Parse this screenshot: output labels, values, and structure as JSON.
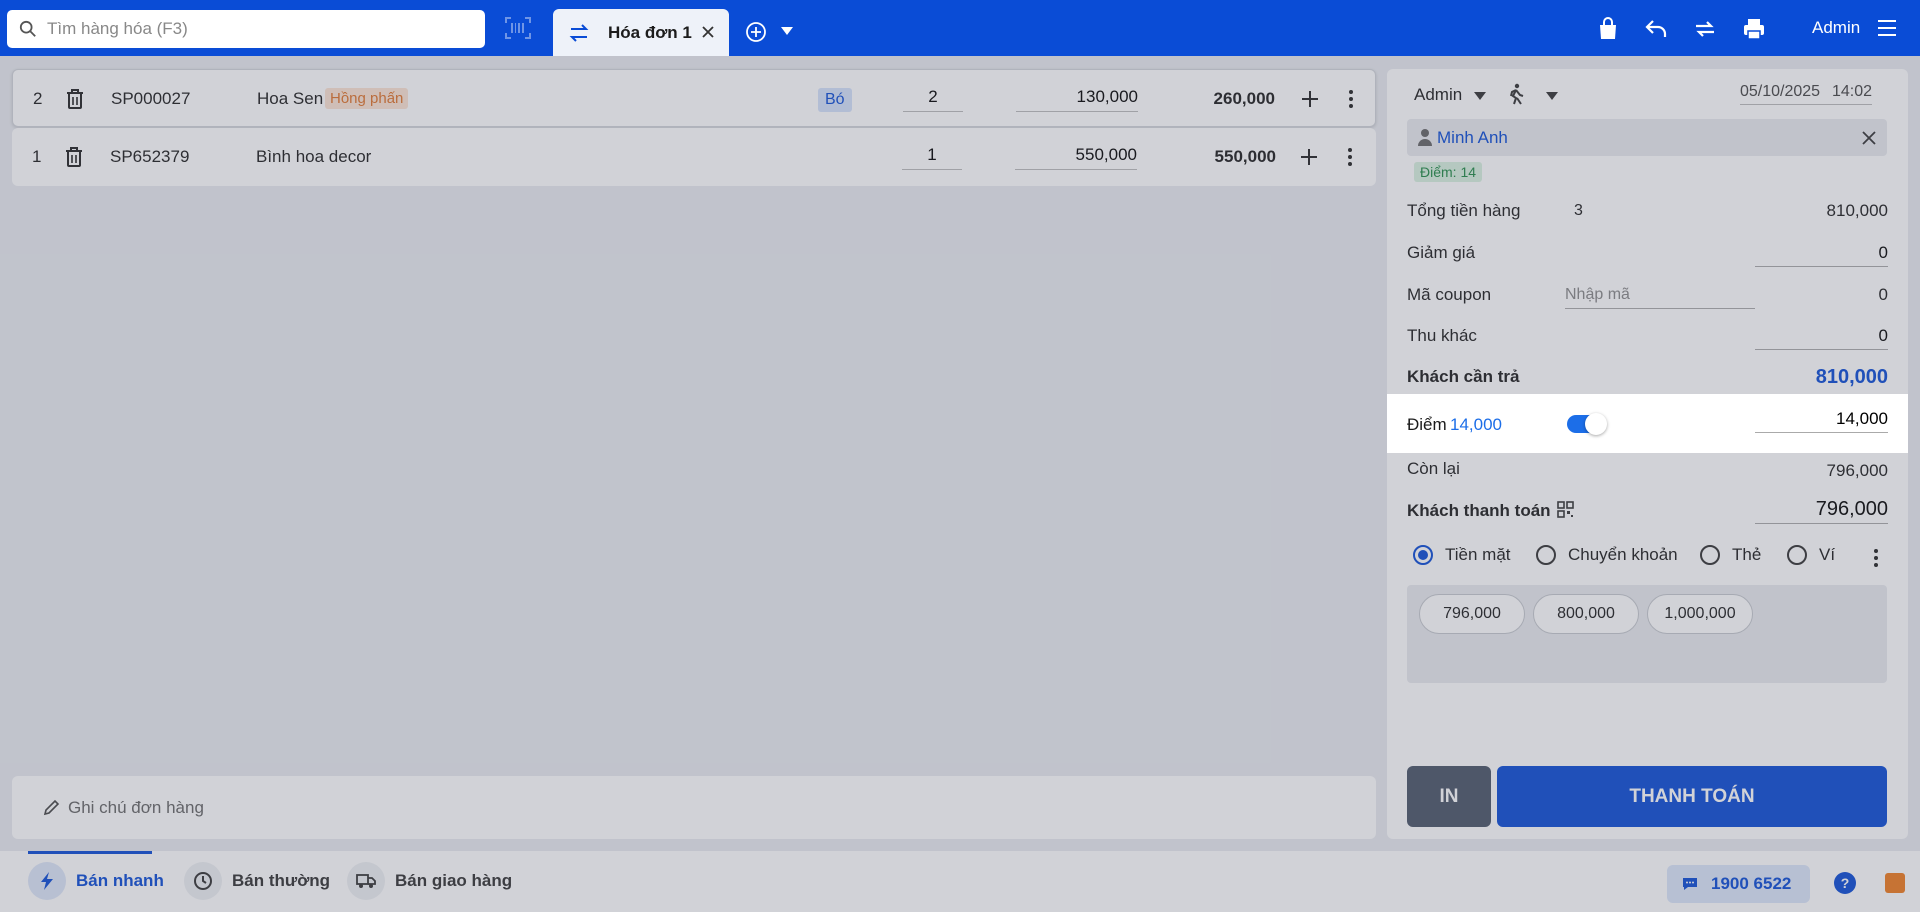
{
  "search": {
    "placeholder": "Tìm hàng hóa (F3)"
  },
  "tabs": [
    {
      "label": "Hóa đơn 1"
    }
  ],
  "header": {
    "user": "Admin"
  },
  "cart": {
    "items": [
      {
        "index": "2",
        "code": "SP000027",
        "name": "Hoa Sen",
        "tag": "Hồng phấn",
        "unit": "Bó",
        "qty": "2",
        "price": "130,000",
        "total": "260,000"
      },
      {
        "index": "1",
        "code": "SP652379",
        "name": "Bình hoa decor",
        "tag": "",
        "unit": "",
        "qty": "1",
        "price": "550,000",
        "total": "550,000"
      }
    ],
    "note_placeholder": "Ghi chú đơn hàng"
  },
  "panel": {
    "seller": "Admin",
    "date": "05/10/2025",
    "time": "14:02",
    "customer": {
      "name": "Minh Anh",
      "points_badge": "Điểm: 14"
    },
    "summary": {
      "subtotal_label": "Tổng tiền hàng",
      "subtotal_count": "3",
      "subtotal_value": "810,000",
      "discount_label": "Giảm giá",
      "discount_value": "0",
      "coupon_label": "Mã coupon",
      "coupon_placeholder": "Nhập mã",
      "coupon_value": "0",
      "other_label": "Thu khác",
      "other_value": "0",
      "due_label": "Khách cần trả",
      "due_value": "810,000",
      "points_label": "Điểm",
      "points_available": "14,000",
      "points_value": "14,000",
      "remaining_label": "Còn lại",
      "remaining_value": "796,000",
      "paid_label": "Khách thanh toán",
      "paid_value": "796,000"
    },
    "payment_methods": [
      "Tiền mặt",
      "Chuyển khoản",
      "Thẻ",
      "Ví"
    ],
    "suggestions": [
      "796,000",
      "800,000",
      "1,000,000"
    ],
    "print_label": "IN",
    "pay_label": "THANH TOÁN"
  },
  "bottom": {
    "modes": [
      "Bán nhanh",
      "Bán thường",
      "Bán giao hàng"
    ],
    "hotline": "1900 6522"
  }
}
